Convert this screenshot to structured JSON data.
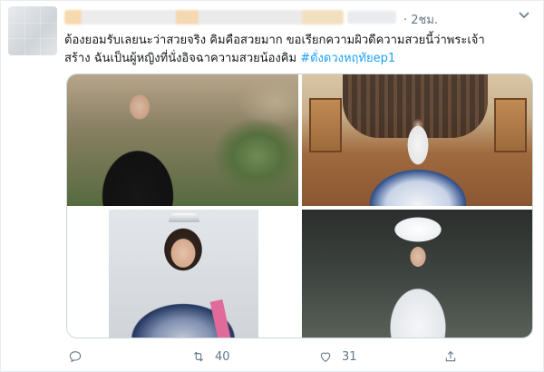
{
  "tweet": {
    "time": "· 2ชม.",
    "text_line1": "ต้องยอมรับเลยนะว่าสวยจริง คิมคือสวยมาก ขอเรียกความผิวดีความสวยนี้ว่าพระเจ้า",
    "text_line2": "สร้าง ฉันเป็นผู้หญิงที่นั่งอิจฉาความสวยน้องคิม",
    "hashtag": "#ดั่งดวงหฤทัยep1",
    "photos": [
      "photo-1",
      "photo-2",
      "photo-3",
      "photo-4"
    ]
  },
  "actions": {
    "reply_count": "",
    "retweet_count": "40",
    "like_count": "31"
  },
  "icons": {
    "reply": "reply-icon",
    "retweet": "retweet-icon",
    "like": "heart-icon",
    "share": "share-icon",
    "menu": "chevron-down-icon"
  },
  "colors": {
    "accent": "#1da1f2",
    "muted": "#657786",
    "text": "#14171a",
    "border": "#e6ecf0"
  }
}
